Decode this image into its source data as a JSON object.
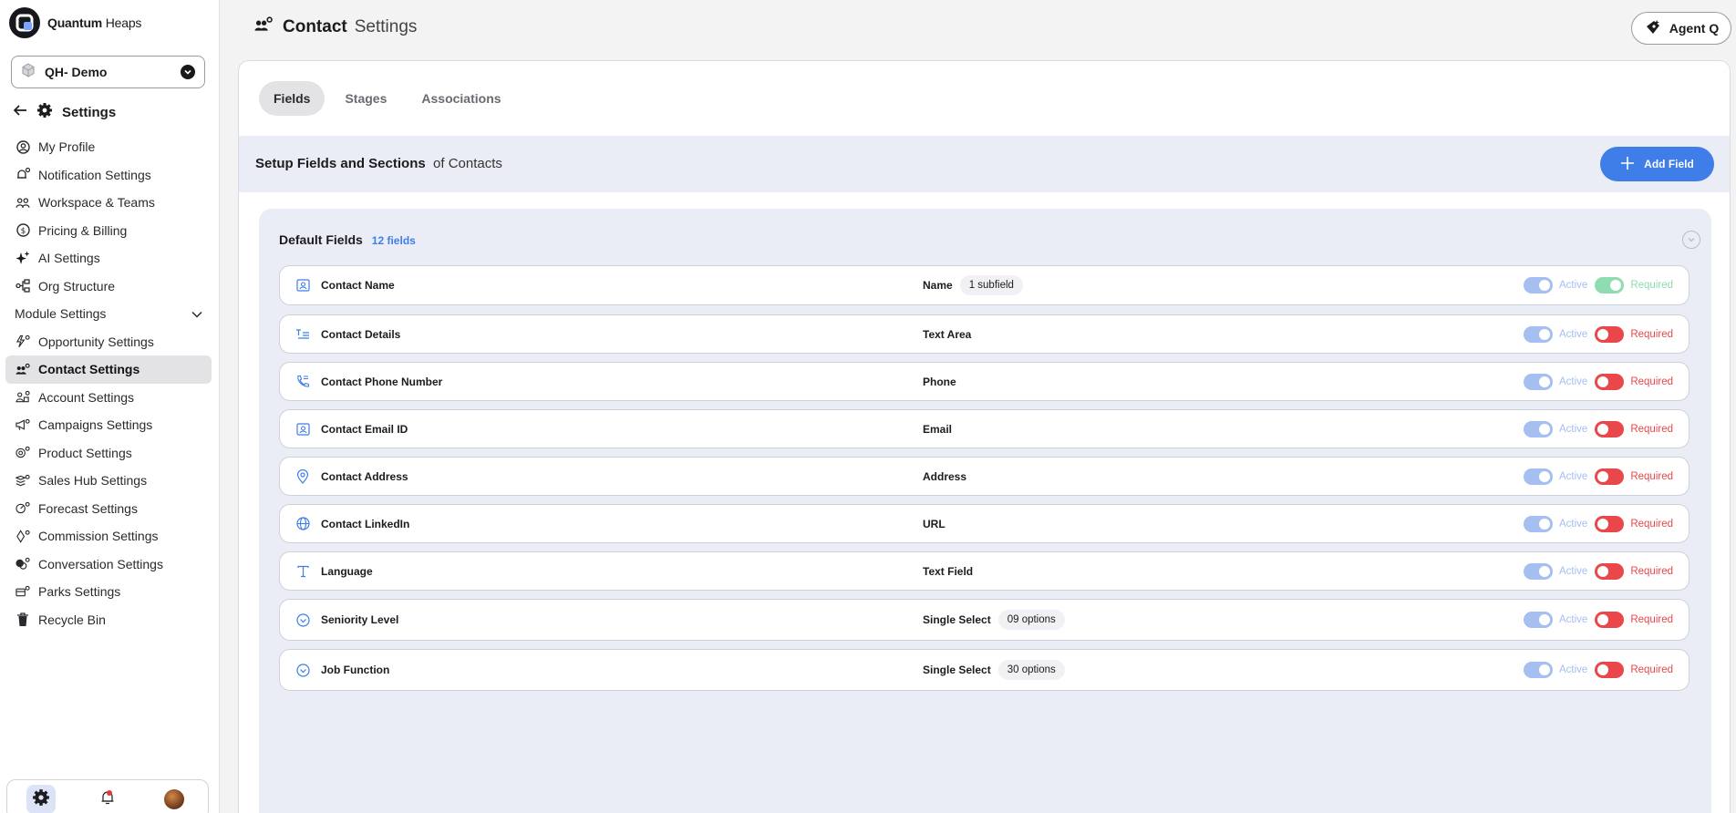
{
  "brand": {
    "name_bold": "Quantum",
    "name_light": "Heaps"
  },
  "workspace": {
    "name": "QH- Demo"
  },
  "settings_header": {
    "back_label": "Settings"
  },
  "nav": {
    "items": [
      {
        "label": "My Profile",
        "icon": "user-circle-icon"
      },
      {
        "label": "Notification Settings",
        "icon": "bell-dot-icon"
      },
      {
        "label": "Workspace & Teams",
        "icon": "users-icon"
      },
      {
        "label": "Pricing & Billing",
        "icon": "dollar-circle-icon"
      },
      {
        "label": "AI Settings",
        "icon": "sparkle-icon"
      },
      {
        "label": "Org Structure",
        "icon": "org-chart-icon"
      }
    ],
    "section_label": "Module Settings",
    "module_items": [
      {
        "label": "Opportunity Settings",
        "icon": "opportunity-icon"
      },
      {
        "label": "Contact Settings",
        "icon": "contacts-icon",
        "active": true
      },
      {
        "label": "Account Settings",
        "icon": "account-icon"
      },
      {
        "label": "Campaigns Settings",
        "icon": "megaphone-icon"
      },
      {
        "label": "Product Settings",
        "icon": "product-icon"
      },
      {
        "label": "Sales Hub Settings",
        "icon": "sales-hub-icon"
      },
      {
        "label": "Forecast Settings",
        "icon": "forecast-icon"
      },
      {
        "label": "Commission Settings",
        "icon": "commission-icon"
      },
      {
        "label": "Conversation Settings",
        "icon": "chat-icon"
      },
      {
        "label": "Parks Settings",
        "icon": "parks-icon"
      },
      {
        "label": "Recycle Bin",
        "icon": "trash-icon"
      }
    ]
  },
  "header": {
    "title_bold": "Contact",
    "title_light": "Settings",
    "agent_label": "Agent Q"
  },
  "tabs": [
    {
      "label": "Fields",
      "active": true
    },
    {
      "label": "Stages"
    },
    {
      "label": "Associations"
    }
  ],
  "setup": {
    "title_bold": "Setup Fields and Sections",
    "title_rest": "of Contacts",
    "add_button": "Add Field"
  },
  "default_fields": {
    "title": "Default Fields",
    "count": "12 fields",
    "active_label": "Active",
    "required_label": "Required",
    "rows": [
      {
        "name": "Contact Name",
        "type": "Name",
        "chip": "1 subfield",
        "icon": "id-card-icon",
        "required_on": true
      },
      {
        "name": "Contact Details",
        "type": "Text Area",
        "chip": "",
        "icon": "text-area-icon",
        "required_on": false
      },
      {
        "name": "Contact Phone Number",
        "type": "Phone",
        "chip": "",
        "icon": "phone-icon",
        "required_on": false
      },
      {
        "name": "Contact Email ID",
        "type": "Email",
        "chip": "",
        "icon": "id-card-icon",
        "required_on": false
      },
      {
        "name": "Contact Address",
        "type": "Address",
        "chip": "",
        "icon": "map-pin-icon",
        "required_on": false
      },
      {
        "name": "Contact LinkedIn",
        "type": "URL",
        "chip": "",
        "icon": "globe-icon",
        "required_on": false
      },
      {
        "name": "Language",
        "type": "Text Field",
        "chip": "",
        "icon": "text-field-icon",
        "required_on": false
      },
      {
        "name": "Seniority Level",
        "type": "Single Select",
        "chip": "09 options",
        "icon": "chevron-circle-icon",
        "required_on": false
      },
      {
        "name": "Job Function",
        "type": "Single Select",
        "chip": "30 options",
        "icon": "chevron-circle-icon",
        "required_on": false
      }
    ]
  },
  "colors": {
    "accent": "#3f7de8",
    "active_toggle": "#a5bff0",
    "required_on": "#8fdcb1",
    "required_off": "#e9474a"
  }
}
